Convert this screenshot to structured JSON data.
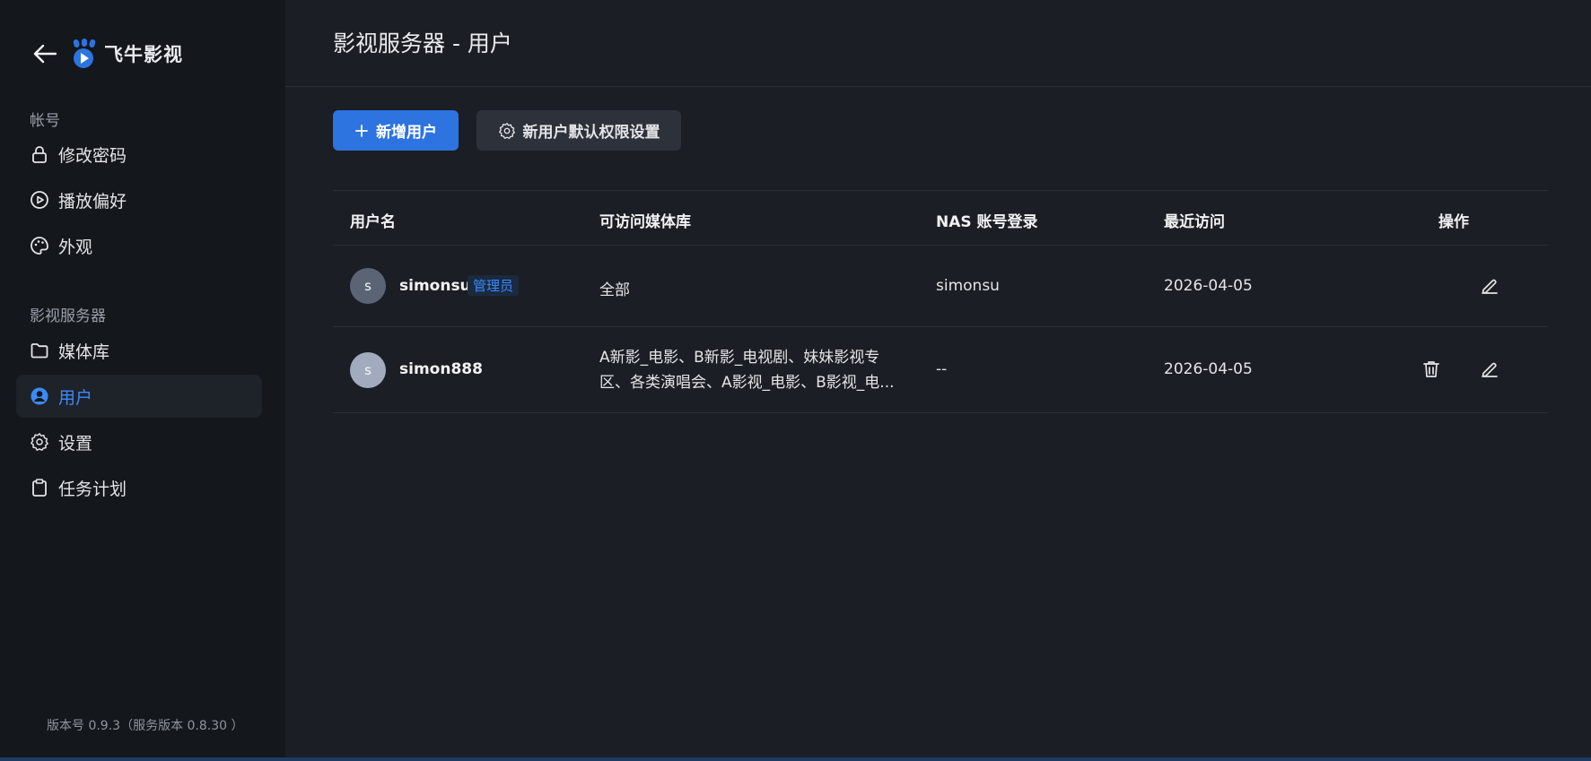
{
  "app": {
    "brand_name": "飞牛影视",
    "version_text": "版本号 0.9.3（服务版本 0.8.30 ）",
    "accent_color": "#2d74e0"
  },
  "sidebar": {
    "sections": [
      {
        "title": "帐号",
        "items": [
          {
            "label": "修改密码",
            "icon": "lock-icon"
          },
          {
            "label": "播放偏好",
            "icon": "play-circle-icon"
          },
          {
            "label": "外观",
            "icon": "palette-icon"
          }
        ]
      },
      {
        "title": "影视服务器",
        "items": [
          {
            "label": "媒体库",
            "icon": "folder-icon"
          },
          {
            "label": "用户",
            "icon": "user-circle-icon",
            "active": true
          },
          {
            "label": "设置",
            "icon": "gear-icon"
          },
          {
            "label": "任务计划",
            "icon": "clipboard-icon"
          }
        ]
      }
    ]
  },
  "main": {
    "title": "影视服务器 - 用户",
    "add_user_label": "新增用户",
    "default_perm_label": "新用户默认权限设置",
    "table": {
      "headers": [
        "用户名",
        "可访问媒体库",
        "NAS 账号登录",
        "最近访问",
        "操作"
      ],
      "rows": [
        {
          "avatar": "s",
          "username": "simonsu",
          "badge": "管理员",
          "libraries_line1": "全部",
          "libraries_line2": "",
          "nas_account": "simonsu",
          "last_access": "2026-04-05"
        },
        {
          "avatar": "s",
          "username": "simon888",
          "badge": "",
          "libraries_line1": "A新影_电影、B新影_电视剧、妹妹影视专",
          "libraries_line2": "区、各类演唱会、A影视_电影、B影视_电...",
          "nas_account": "--",
          "last_access": "2026-04-05"
        }
      ]
    }
  }
}
